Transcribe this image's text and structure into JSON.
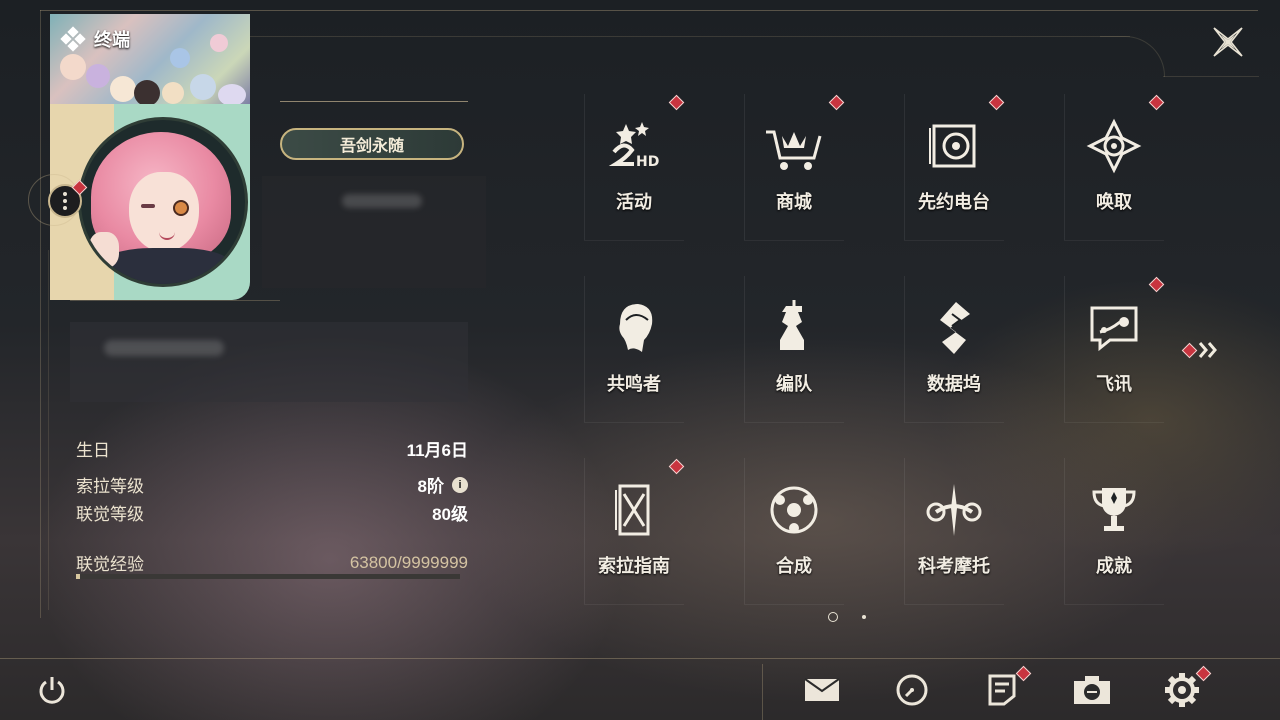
{
  "header": {
    "title": "终端",
    "close_icon": "close-x-icon"
  },
  "profile": {
    "name_plate": "吾剑永随",
    "menu_icon": "more-vertical-icon",
    "birthday_label": "生日",
    "birthday_value": "11月6日",
    "sola_level_label": "索拉等级",
    "sola_level_value": "8阶",
    "sola_info_icon": "i",
    "union_level_label": "联觉等级",
    "union_level_value": "80级",
    "union_exp_label": "联觉经验",
    "union_exp_value": "63800/9999999",
    "union_exp_fraction": 0.0064
  },
  "menu_grid": [
    {
      "label": "活动",
      "icon": "event-2nd-anniversary-icon",
      "alert": true
    },
    {
      "label": "商城",
      "icon": "shop-cart-crown-icon",
      "alert": true
    },
    {
      "label": "先约电台",
      "icon": "radio-icon",
      "alert": true
    },
    {
      "label": "唤取",
      "icon": "convene-icon",
      "alert": true
    },
    {
      "label": "共鸣者",
      "icon": "resonator-icon",
      "alert": false
    },
    {
      "label": "编队",
      "icon": "team-chess-icon",
      "alert": false
    },
    {
      "label": "数据坞",
      "icon": "data-bank-icon",
      "alert": false
    },
    {
      "label": "飞讯",
      "icon": "message-icon",
      "alert": true
    },
    {
      "label": "索拉指南",
      "icon": "guidebook-icon",
      "alert": true
    },
    {
      "label": "合成",
      "icon": "synthesis-icon",
      "alert": false
    },
    {
      "label": "科考摩托",
      "icon": "motorcycle-icon",
      "alert": false
    },
    {
      "label": "成就",
      "icon": "trophy-icon",
      "alert": false
    }
  ],
  "pagination": {
    "pages": 2,
    "current": 1,
    "next_icon": "double-chevron-right-icon"
  },
  "bottom_bar": {
    "power_icon": "power-icon",
    "buttons": [
      {
        "icon": "mail-icon",
        "alert": false
      },
      {
        "icon": "clock-icon",
        "alert": false
      },
      {
        "icon": "notice-icon",
        "alert": true
      },
      {
        "icon": "camera-icon",
        "alert": false
      },
      {
        "icon": "settings-gear-icon",
        "alert": true
      }
    ]
  },
  "colors": {
    "accent_gold": "#c7b47f",
    "alert_red": "#c8343f",
    "text": "#f2ede3"
  }
}
